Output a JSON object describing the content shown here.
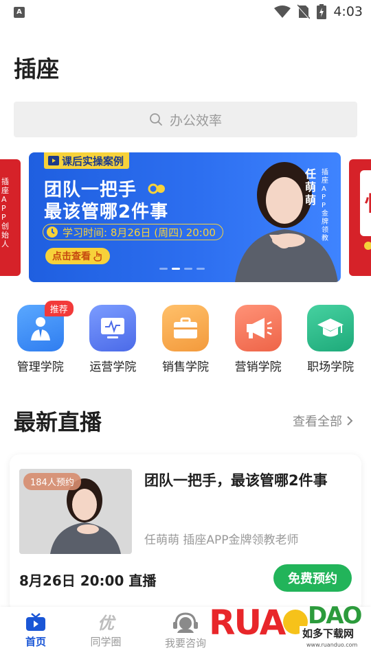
{
  "status_bar": {
    "time": "4:03",
    "app_icon": "A"
  },
  "header": {
    "title": "插座"
  },
  "search": {
    "placeholder": "办公效率"
  },
  "banner": {
    "tag": "课后实操案例",
    "title_line1": "团队一把手",
    "title_line2": "最该管哪2件事",
    "time": "学习时间: 8月26日 (周四) 20:00",
    "button": "点击查看",
    "speaker": "任萌萌",
    "speaker_role": "插座APP金牌领教",
    "left_peek_text": "插座APP创始人",
    "right_peek_char": "忄",
    "colors": {
      "blue": "#2563eb",
      "yellow": "#f7d23a",
      "red": "#d62229"
    }
  },
  "categories": [
    {
      "label": "管理学院",
      "badge": "推荐",
      "icon": "manager-icon",
      "color": "#3b8cf5"
    },
    {
      "label": "运营学院",
      "icon": "monitor-chart-icon",
      "color": "#5b7cf0"
    },
    {
      "label": "销售学院",
      "icon": "briefcase-icon",
      "color": "#f6a44e"
    },
    {
      "label": "营销学院",
      "icon": "megaphone-icon",
      "color": "#f2745d"
    },
    {
      "label": "职场学院",
      "icon": "graduation-cap-icon",
      "color": "#27ba8a"
    }
  ],
  "live_section": {
    "title": "最新直播",
    "see_all": "查看全部",
    "card": {
      "badge": "184人预约",
      "title": "团队一把手，最该管哪2件事",
      "subtitle": "任萌萌 插座APP金牌领教老师",
      "time": "8月26日 20:00 直播",
      "button": "免费预约"
    }
  },
  "tabbar": {
    "items": [
      {
        "label": "首页",
        "active": true,
        "icon": "tv-icon"
      },
      {
        "label": "同学圈",
        "active": false,
        "icon": "you-icon"
      },
      {
        "label": "我要咨询",
        "active": false,
        "icon": "headset-icon"
      }
    ]
  },
  "watermark": {
    "brand": "RUANDAO",
    "text": "如多下载网",
    "url": "www.ruanduo.com"
  }
}
